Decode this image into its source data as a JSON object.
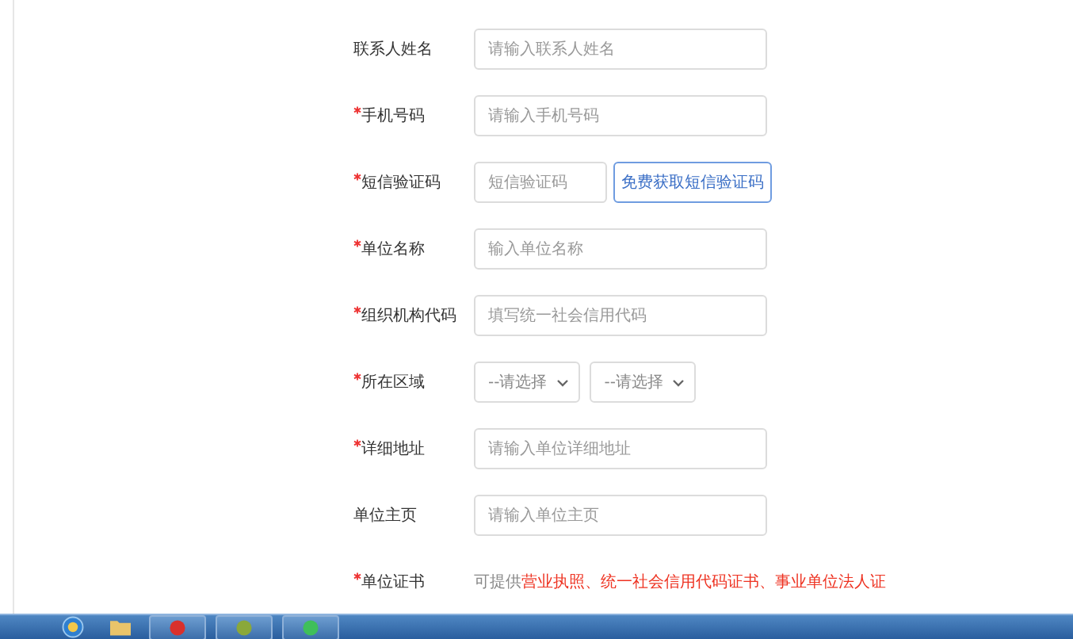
{
  "form": {
    "fields": [
      {
        "kind": "input",
        "label": "联系人姓名",
        "required": false,
        "placeholder": "请输入联系人姓名"
      },
      {
        "kind": "input",
        "label": "手机号码",
        "required": true,
        "placeholder": "请输入手机号码"
      },
      {
        "kind": "sms",
        "label": "短信验证码",
        "required": true,
        "placeholder": "短信验证码",
        "button": "免费获取短信验证码"
      },
      {
        "kind": "input",
        "label": "单位名称",
        "required": true,
        "placeholder": "输入单位名称"
      },
      {
        "kind": "input",
        "label": "组织机构代码",
        "required": true,
        "placeholder": "填写统一社会信用代码"
      },
      {
        "kind": "selects",
        "label": "所在区域",
        "required": true,
        "selects": [
          "--请选择",
          "--请选择"
        ]
      },
      {
        "kind": "input",
        "label": "详细地址",
        "required": true,
        "placeholder": "请输入单位详细地址"
      },
      {
        "kind": "input",
        "label": "单位主页",
        "required": false,
        "placeholder": "请输入单位主页"
      },
      {
        "kind": "note",
        "label": "单位证书",
        "required": true,
        "parts": [
          {
            "text": "可提供",
            "highlight": false
          },
          {
            "text": "营业执照、统一社会信用代码证书、事业单位法人证",
            "highlight": true
          }
        ]
      }
    ]
  },
  "taskbar": {
    "apps": [
      {
        "kind": "red"
      },
      {
        "kind": "olive"
      },
      {
        "kind": "green"
      }
    ]
  }
}
